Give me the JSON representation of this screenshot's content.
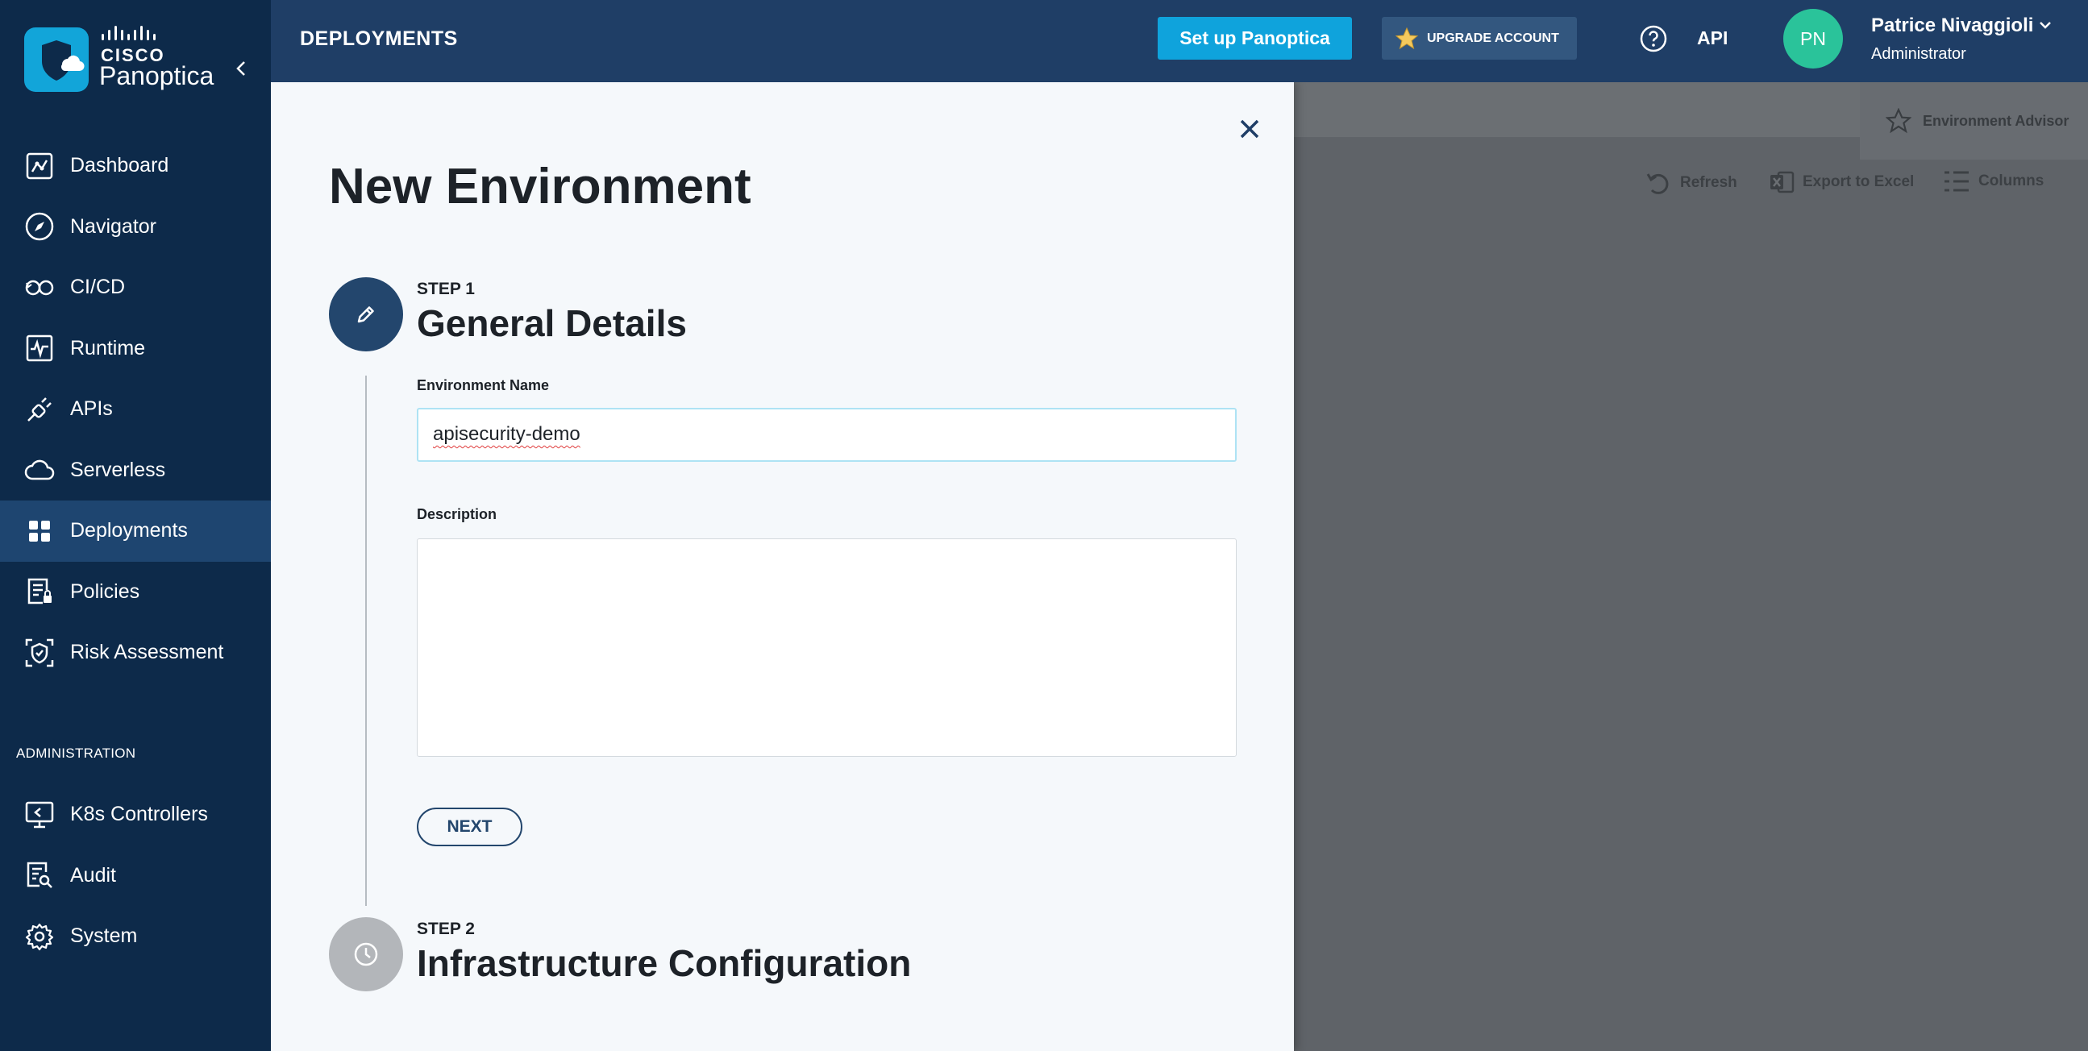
{
  "brand": {
    "company": "CISCO",
    "product": "Panoptica"
  },
  "nav": {
    "items": [
      {
        "label": "Dashboard",
        "icon": "dashboard-icon"
      },
      {
        "label": "Navigator",
        "icon": "compass-icon"
      },
      {
        "label": "CI/CD",
        "icon": "cicd-icon"
      },
      {
        "label": "Runtime",
        "icon": "runtime-icon"
      },
      {
        "label": "APIs",
        "icon": "plug-icon"
      },
      {
        "label": "Serverless",
        "icon": "cloud-icon"
      },
      {
        "label": "Deployments",
        "icon": "grid-icon",
        "active": true
      },
      {
        "label": "Policies",
        "icon": "policy-icon"
      },
      {
        "label": "Risk Assessment",
        "icon": "shield-scan-icon"
      }
    ],
    "admin_section": "ADMINISTRATION",
    "admin_items": [
      {
        "label": "K8s Controllers",
        "icon": "monitor-icon"
      },
      {
        "label": "Audit",
        "icon": "audit-icon"
      },
      {
        "label": "System",
        "icon": "gear-icon"
      }
    ]
  },
  "header": {
    "title": "DEPLOYMENTS",
    "setup_label": "Set up Panoptica",
    "upgrade_label": "UPGRADE ACCOUNT",
    "api_label": "API",
    "avatar_initials": "PN",
    "user_name": "Patrice Nivaggioli",
    "user_role": "Administrator"
  },
  "background": {
    "advisor_label": "Environment Advisor",
    "refresh_label": "Refresh",
    "export_label": "Export to Excel",
    "columns_label": "Columns"
  },
  "drawer": {
    "title": "New Environment",
    "step1": {
      "label": "STEP 1",
      "title": "General Details",
      "name_label": "Environment Name",
      "name_value": "apisecurity-demo",
      "description_label": "Description",
      "description_value": "",
      "next_label": "NEXT"
    },
    "step2": {
      "label": "STEP 2",
      "title": "Infrastructure Configuration"
    }
  },
  "colors": {
    "sidebar": "#0d2a4a",
    "header": "#1f3e66",
    "accent": "#0fa3dc",
    "avatar": "#2ac39a"
  }
}
